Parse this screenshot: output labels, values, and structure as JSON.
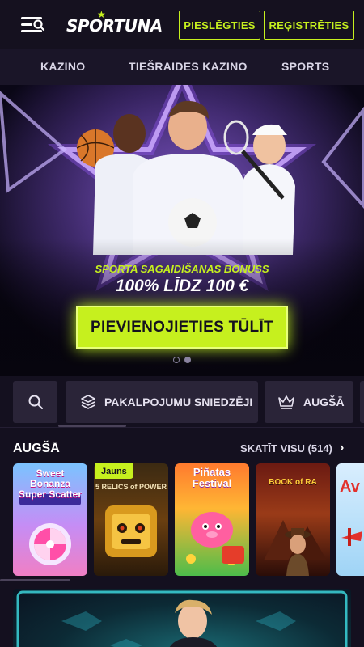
{
  "header": {
    "logo_text": "SPORTUNA",
    "login_label": "PIESLĒGTIES",
    "register_label": "REĢISTRĒTIES"
  },
  "nav": {
    "items": [
      {
        "label": "KAZINO"
      },
      {
        "label": "TIEŠRAIDES KAZINO"
      },
      {
        "label": "SPORTS"
      }
    ]
  },
  "hero": {
    "subtitle": "SPORTA SAGAIDĪŠANAS BONUSS",
    "title": "100% LĪDZ 100 €",
    "cta_label": "PIEVIENOJIETIES TŪLĪT",
    "slides_total": 2,
    "slide_active": 2
  },
  "filters": {
    "providers_label": "PAKALPOJUMU SNIEDZĒJI",
    "top_label": "AUGŠĀ"
  },
  "section": {
    "title": "AUGŠĀ",
    "see_all_label": "SKATĪT VISU (514)"
  },
  "games": [
    {
      "name": "Sweet Bonanza Super Scatter",
      "label": "Sweet\nBonanza\nSuper Scatter",
      "badge": ""
    },
    {
      "name": "5 Relics of Power",
      "label": "5 RELICS of POWER",
      "badge": "Jauns"
    },
    {
      "name": "Piñatas Festival",
      "label": "Piñatas\nFestival",
      "badge": ""
    },
    {
      "name": "Book of Ra",
      "label": "BOOK of RA",
      "badge": ""
    },
    {
      "name": "Aviator",
      "label": "Av",
      "badge": ""
    }
  ],
  "colors": {
    "accent": "#c6f01e",
    "background": "#14101f",
    "nav_bg": "#1a1528",
    "chip_bg": "#2a2438"
  },
  "icons": {
    "menu": "menu-search-icon",
    "search": "search-icon",
    "providers": "layers-icon",
    "top": "crown-icon",
    "chevron": "chevron-right-icon"
  }
}
